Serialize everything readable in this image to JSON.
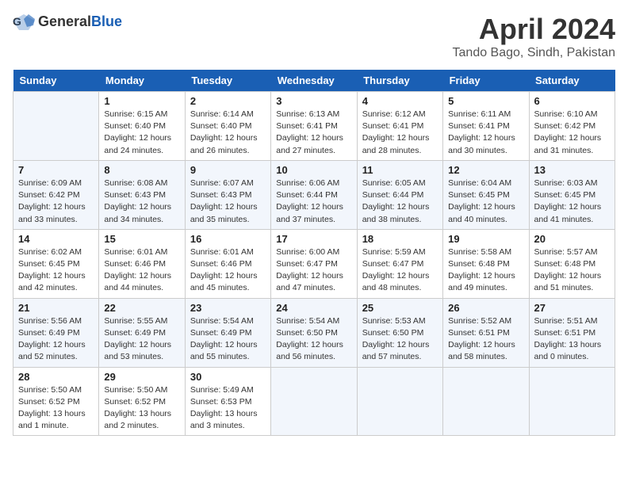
{
  "header": {
    "logo_general": "General",
    "logo_blue": "Blue",
    "month_title": "April 2024",
    "location": "Tando Bago, Sindh, Pakistan"
  },
  "days_of_week": [
    "Sunday",
    "Monday",
    "Tuesday",
    "Wednesday",
    "Thursday",
    "Friday",
    "Saturday"
  ],
  "weeks": [
    [
      {
        "day": null
      },
      {
        "day": 1,
        "sunrise": "6:15 AM",
        "sunset": "6:40 PM",
        "daylight": "12 hours and 24 minutes."
      },
      {
        "day": 2,
        "sunrise": "6:14 AM",
        "sunset": "6:40 PM",
        "daylight": "12 hours and 26 minutes."
      },
      {
        "day": 3,
        "sunrise": "6:13 AM",
        "sunset": "6:41 PM",
        "daylight": "12 hours and 27 minutes."
      },
      {
        "day": 4,
        "sunrise": "6:12 AM",
        "sunset": "6:41 PM",
        "daylight": "12 hours and 28 minutes."
      },
      {
        "day": 5,
        "sunrise": "6:11 AM",
        "sunset": "6:41 PM",
        "daylight": "12 hours and 30 minutes."
      },
      {
        "day": 6,
        "sunrise": "6:10 AM",
        "sunset": "6:42 PM",
        "daylight": "12 hours and 31 minutes."
      }
    ],
    [
      {
        "day": 7,
        "sunrise": "6:09 AM",
        "sunset": "6:42 PM",
        "daylight": "12 hours and 33 minutes."
      },
      {
        "day": 8,
        "sunrise": "6:08 AM",
        "sunset": "6:43 PM",
        "daylight": "12 hours and 34 minutes."
      },
      {
        "day": 9,
        "sunrise": "6:07 AM",
        "sunset": "6:43 PM",
        "daylight": "12 hours and 35 minutes."
      },
      {
        "day": 10,
        "sunrise": "6:06 AM",
        "sunset": "6:44 PM",
        "daylight": "12 hours and 37 minutes."
      },
      {
        "day": 11,
        "sunrise": "6:05 AM",
        "sunset": "6:44 PM",
        "daylight": "12 hours and 38 minutes."
      },
      {
        "day": 12,
        "sunrise": "6:04 AM",
        "sunset": "6:45 PM",
        "daylight": "12 hours and 40 minutes."
      },
      {
        "day": 13,
        "sunrise": "6:03 AM",
        "sunset": "6:45 PM",
        "daylight": "12 hours and 41 minutes."
      }
    ],
    [
      {
        "day": 14,
        "sunrise": "6:02 AM",
        "sunset": "6:45 PM",
        "daylight": "12 hours and 42 minutes."
      },
      {
        "day": 15,
        "sunrise": "6:01 AM",
        "sunset": "6:46 PM",
        "daylight": "12 hours and 44 minutes."
      },
      {
        "day": 16,
        "sunrise": "6:01 AM",
        "sunset": "6:46 PM",
        "daylight": "12 hours and 45 minutes."
      },
      {
        "day": 17,
        "sunrise": "6:00 AM",
        "sunset": "6:47 PM",
        "daylight": "12 hours and 47 minutes."
      },
      {
        "day": 18,
        "sunrise": "5:59 AM",
        "sunset": "6:47 PM",
        "daylight": "12 hours and 48 minutes."
      },
      {
        "day": 19,
        "sunrise": "5:58 AM",
        "sunset": "6:48 PM",
        "daylight": "12 hours and 49 minutes."
      },
      {
        "day": 20,
        "sunrise": "5:57 AM",
        "sunset": "6:48 PM",
        "daylight": "12 hours and 51 minutes."
      }
    ],
    [
      {
        "day": 21,
        "sunrise": "5:56 AM",
        "sunset": "6:49 PM",
        "daylight": "12 hours and 52 minutes."
      },
      {
        "day": 22,
        "sunrise": "5:55 AM",
        "sunset": "6:49 PM",
        "daylight": "12 hours and 53 minutes."
      },
      {
        "day": 23,
        "sunrise": "5:54 AM",
        "sunset": "6:49 PM",
        "daylight": "12 hours and 55 minutes."
      },
      {
        "day": 24,
        "sunrise": "5:54 AM",
        "sunset": "6:50 PM",
        "daylight": "12 hours and 56 minutes."
      },
      {
        "day": 25,
        "sunrise": "5:53 AM",
        "sunset": "6:50 PM",
        "daylight": "12 hours and 57 minutes."
      },
      {
        "day": 26,
        "sunrise": "5:52 AM",
        "sunset": "6:51 PM",
        "daylight": "12 hours and 58 minutes."
      },
      {
        "day": 27,
        "sunrise": "5:51 AM",
        "sunset": "6:51 PM",
        "daylight": "13 hours and 0 minutes."
      }
    ],
    [
      {
        "day": 28,
        "sunrise": "5:50 AM",
        "sunset": "6:52 PM",
        "daylight": "13 hours and 1 minute."
      },
      {
        "day": 29,
        "sunrise": "5:50 AM",
        "sunset": "6:52 PM",
        "daylight": "13 hours and 2 minutes."
      },
      {
        "day": 30,
        "sunrise": "5:49 AM",
        "sunset": "6:53 PM",
        "daylight": "13 hours and 3 minutes."
      },
      {
        "day": null
      },
      {
        "day": null
      },
      {
        "day": null
      },
      {
        "day": null
      }
    ]
  ]
}
